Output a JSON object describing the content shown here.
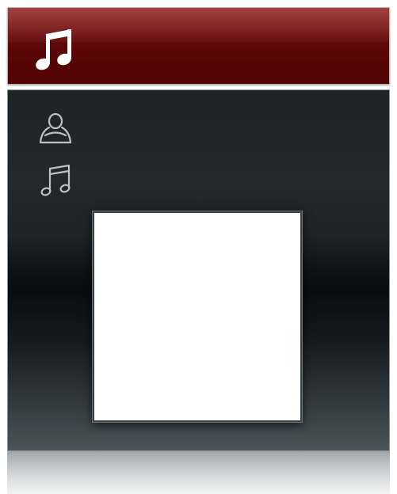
{
  "header": {
    "icon": "music-note-icon",
    "color": "#560505"
  },
  "nav": {
    "items": [
      {
        "icon": "person-icon"
      },
      {
        "icon": "music-note-icon"
      }
    ]
  },
  "artwork": {
    "background": "#ffffff"
  },
  "colors": {
    "panel_background": "#1f2326",
    "icon_color": "#b9c2c8"
  }
}
